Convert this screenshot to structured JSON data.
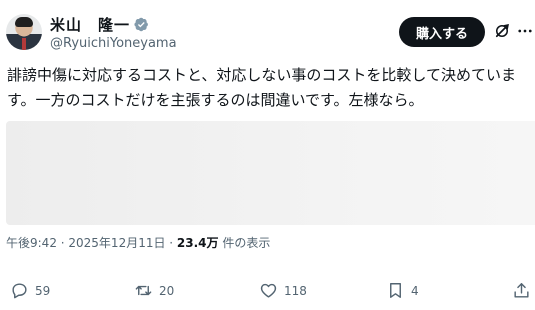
{
  "author": {
    "display_name": "米山　隆一",
    "handle": "@RyuichiYoneyama",
    "verified_color": "#829aab"
  },
  "header": {
    "buy_label": "購入する",
    "grok_icon": "grok-icon",
    "more_icon": "more-horizontal-icon"
  },
  "post": {
    "text": "誹謗中傷に対応するコストと、対応しない事のコストを比較して決めています。一方のコストだけを主張するのは間違いです。左様なら。",
    "timestamp": "午後9:42 · 2025年12月11日 · ",
    "views_value": "23.4万",
    "views_suffix": " 件の表示"
  },
  "actions": {
    "replies": "59",
    "reposts": "20",
    "likes": "118",
    "bookmarks": "4"
  },
  "colors": {
    "text": "#0f1419",
    "secondary": "#536471",
    "button_bg": "#0f1419"
  }
}
